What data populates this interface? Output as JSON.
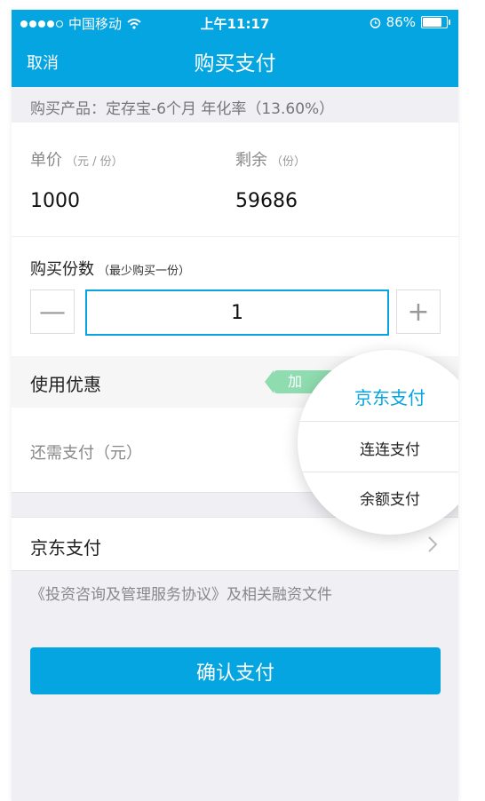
{
  "status_bar": {
    "carrier": "中国移动",
    "time": "上午11:17",
    "battery": "86%",
    "battery_level": 0.86
  },
  "nav": {
    "cancel_label": "取消",
    "title": "购买支付"
  },
  "product_line": "购买产品：定存宝-6个月 年化率（13.60%）",
  "price": {
    "label": "单价",
    "unit": "（元 / 份）",
    "value": "1000"
  },
  "remaining": {
    "label": "剩余",
    "unit": "（份）",
    "value": "59686"
  },
  "quantity": {
    "label": "购买份数",
    "hint": "（最少购买一份）",
    "minus": "—",
    "plus": "+",
    "value": "1"
  },
  "discount": {
    "label": "使用优惠",
    "tag": "加"
  },
  "amount_due": {
    "label": "还需支付（元）"
  },
  "payment_method": {
    "label": "京东支付"
  },
  "agreement": "《投资咨询及管理服务协议》及相关融资文件",
  "confirm_label": "确认支付",
  "payment_popup": {
    "options": [
      "京东支付",
      "连连支付",
      "余额支付"
    ],
    "selected": "京东支付"
  },
  "colors": {
    "primary": "#04a5e0",
    "tag_green": "#8fdcb0",
    "background": "#f0eff4"
  }
}
